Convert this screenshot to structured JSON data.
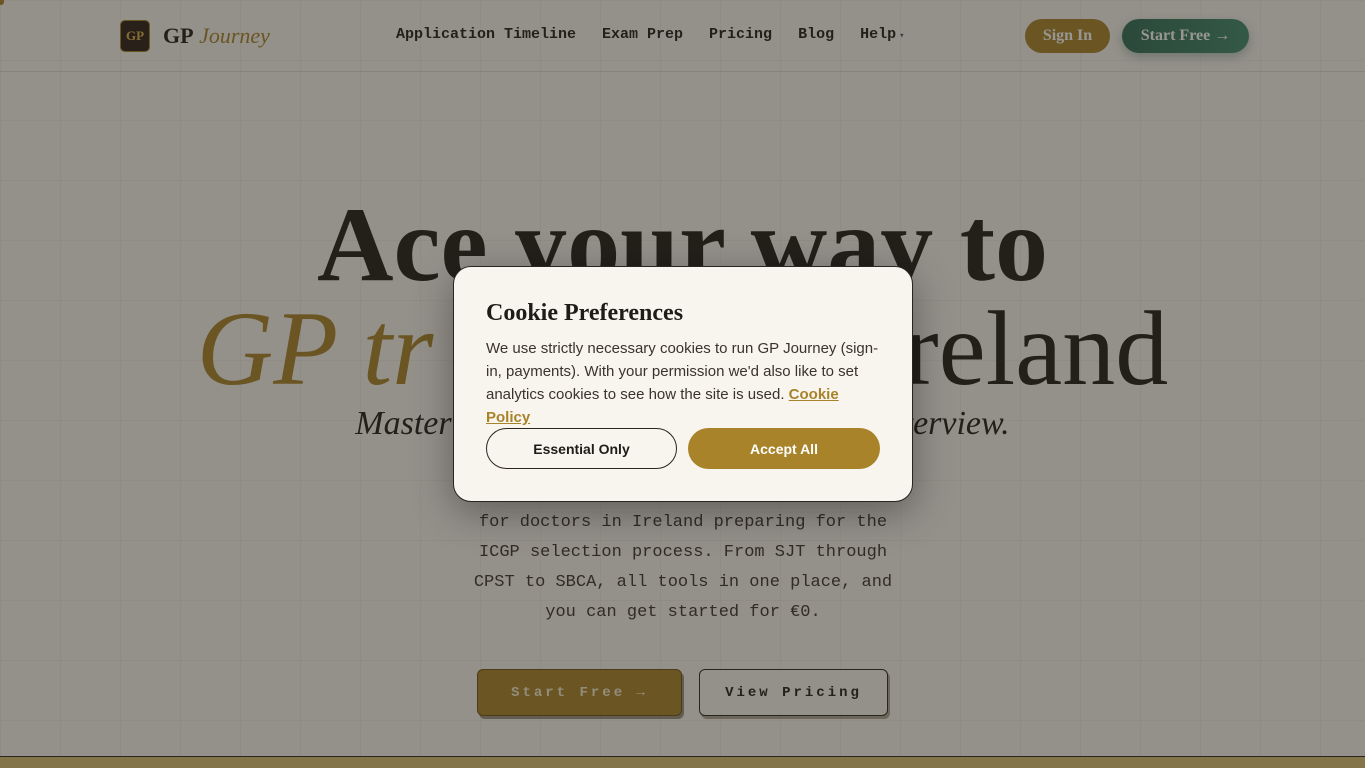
{
  "nav": {
    "logo_badge": "GP",
    "logo_gp": "GP",
    "logo_journey": "Journey",
    "links": [
      "Application Timeline",
      "Exam Prep",
      "Pricing",
      "Blog",
      "Help"
    ],
    "help_caret_icon": "chevron-down-icon",
    "sign_in": "Sign In",
    "start_free": "Start Free →"
  },
  "hero": {
    "line1": "Ace your way to",
    "line2_accent": "GP tr",
    "line2_rest": "reland",
    "sub_left": "Master",
    "sub_right": "terview.",
    "description": "for doctors in Ireland preparing for the ICGP selection process. From SJT through CPST to SBCA, all tools in one place, and you can get started for €0.",
    "cta_start": "Start Free →",
    "cta_pricing": "View Pricing"
  },
  "cookie_modal": {
    "title": "Cookie Preferences",
    "text": "We use strictly necessary cookies to run GP Journey (sign-in, payments). With your permission we'd also like to set analytics cookies to see how the site is used.",
    "policy_link": "Cookie Policy",
    "essential_button": "Essential Only",
    "accept_button": "Accept All"
  },
  "colors": {
    "accent_gold": "#a8832a",
    "accent_green": "#2f6b55",
    "background": "#f7f4ee",
    "text_dark": "#1f1b16"
  }
}
